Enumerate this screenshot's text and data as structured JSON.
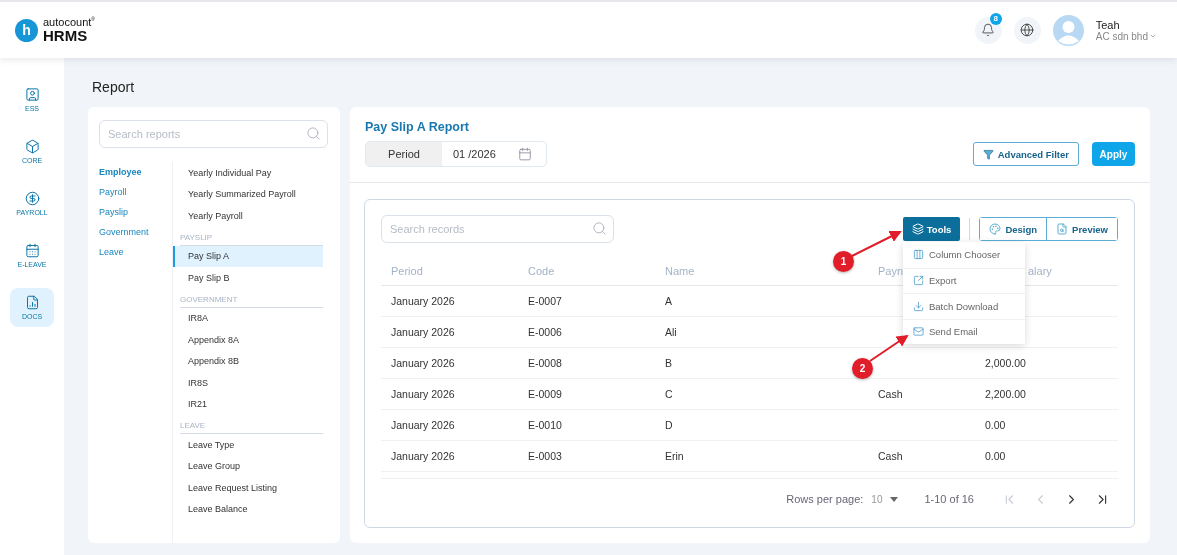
{
  "header": {
    "logo": {
      "mark": "h",
      "name": "autocount",
      "reg": "®",
      "product": "HRMS"
    },
    "notifications": {
      "count": "8"
    },
    "user": {
      "name": "Teah",
      "company": "AC sdn bhd"
    }
  },
  "rail": [
    {
      "kind": "ess",
      "label": "ESS",
      "selected": false
    },
    {
      "kind": "core",
      "label": "CORE",
      "selected": false
    },
    {
      "kind": "payroll",
      "label": "PAYROLL",
      "selected": false
    },
    {
      "kind": "leave",
      "label": "E-LEAVE",
      "selected": false
    },
    {
      "kind": "docs",
      "label": "DOCS",
      "selected": true
    }
  ],
  "page_title": "Report",
  "report_browser": {
    "search": {
      "placeholder": "Search reports"
    },
    "categories": [
      {
        "label": "Employee",
        "selected": true
      },
      {
        "label": "Payroll",
        "selected": false
      },
      {
        "label": "Payslip",
        "selected": false
      },
      {
        "label": "Government",
        "selected": false
      },
      {
        "label": "Leave",
        "selected": false
      }
    ],
    "groups": [
      {
        "items": [
          {
            "label": "Yearly Individual Pay",
            "selected": false
          },
          {
            "label": "Yearly Summarized Payroll",
            "selected": false
          },
          {
            "label": "Yearly Payroll",
            "selected": false
          }
        ]
      },
      {
        "heading": "PAYSLIP",
        "items": [
          {
            "label": "Pay Slip A",
            "selected": true
          },
          {
            "label": "Pay Slip B",
            "selected": false
          }
        ]
      },
      {
        "heading": "GOVERNMENT",
        "items": [
          {
            "label": "IR8A",
            "selected": false
          },
          {
            "label": "Appendix 8A",
            "selected": false
          },
          {
            "label": "Appendix 8B",
            "selected": false
          },
          {
            "label": "IR8S",
            "selected": false
          },
          {
            "label": "IR21",
            "selected": false
          }
        ]
      },
      {
        "heading": "LEAVE",
        "items": [
          {
            "label": "Leave Type",
            "selected": false
          },
          {
            "label": "Leave Group",
            "selected": false
          },
          {
            "label": "Leave Request Listing",
            "selected": false
          },
          {
            "label": "Leave Balance",
            "selected": false
          }
        ]
      }
    ]
  },
  "report": {
    "title": "Pay Slip A Report",
    "period": {
      "label": "Period",
      "value": "01 /2026"
    },
    "advanced_filter": "Advanced Filter",
    "apply": "Apply",
    "records": {
      "search": {
        "placeholder": "Search records"
      },
      "tools": "Tools",
      "design": "Design",
      "preview": "Preview",
      "tools_menu": [
        {
          "kind": "columns",
          "label": "Column Chooser"
        },
        {
          "kind": "export",
          "label": "Export"
        },
        {
          "kind": "download",
          "label": "Batch Download"
        },
        {
          "kind": "email",
          "label": "Send Email"
        }
      ],
      "columns": [
        "Period",
        "Code",
        "Name",
        "Payn",
        "alary"
      ],
      "rows": [
        {
          "period": "January 2026",
          "code": "E-0007",
          "name": "A"
        },
        {
          "period": "January 2026",
          "code": "E-0006",
          "name": "Ali"
        },
        {
          "period": "January 2026",
          "code": "E-0008",
          "name": "B",
          "salary": "2,000.00"
        },
        {
          "period": "January 2026",
          "code": "E-0009",
          "name": "C",
          "payment": "Cash",
          "salary": "2,200.00"
        },
        {
          "period": "January 2026",
          "code": "E-0010",
          "name": "D",
          "salary": "0.00"
        },
        {
          "period": "January 2026",
          "code": "E-0003",
          "name": "Erin",
          "payment": "Cash",
          "salary": "0.00"
        }
      ],
      "pagination": {
        "rows_per_page_label": "Rows per page:",
        "rows_per_page": "10",
        "range": "1-10 of 16",
        "buttons": [
          {
            "kind": "first",
            "disabled": true
          },
          {
            "kind": "prev",
            "disabled": true
          },
          {
            "kind": "next",
            "disabled": false
          },
          {
            "kind": "last",
            "disabled": false
          }
        ]
      }
    }
  },
  "annotations": [
    {
      "label": "1"
    },
    {
      "label": "2"
    }
  ]
}
